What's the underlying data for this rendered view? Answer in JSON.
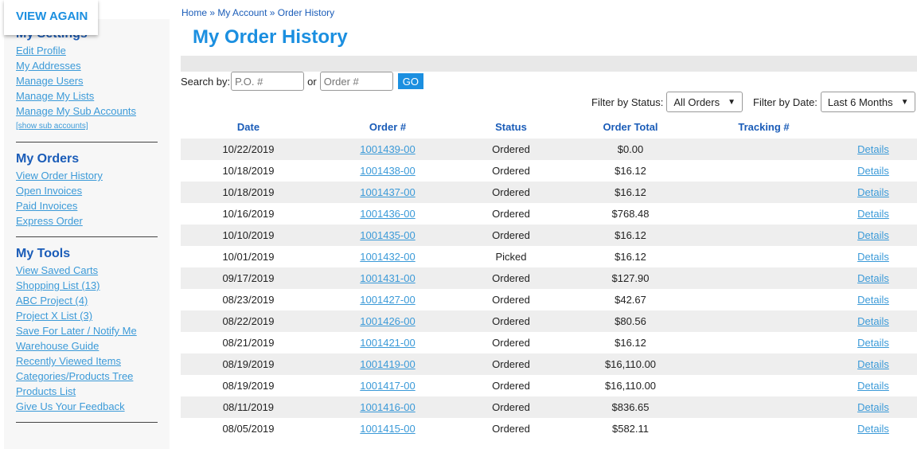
{
  "popup": {
    "label": "VIEW AGAIN"
  },
  "sidebar": {
    "settings": {
      "title": "My Settings",
      "items": [
        "Edit Profile",
        "My Addresses",
        "Manage Users",
        "Manage My Lists",
        "Manage My Sub Accounts"
      ],
      "small": "[show sub accounts]"
    },
    "orders": {
      "title": "My Orders",
      "items": [
        "View Order History",
        "Open Invoices",
        "Paid Invoices",
        "Express Order"
      ]
    },
    "tools": {
      "title": "My Tools",
      "items": [
        "View Saved Carts",
        "Shopping List (13)",
        "ABC Project (4)",
        "Project X List (3)",
        "Save For Later / Notify Me",
        "Warehouse Guide",
        "Recently Viewed Items",
        "Categories/Products Tree",
        "Products List",
        "Give Us Your Feedback"
      ]
    }
  },
  "breadcrumb": {
    "home": "Home",
    "sep": "»",
    "account": "My Account",
    "current": "Order History"
  },
  "page_title": "My Order History",
  "search": {
    "label": "Search by:",
    "po_placeholder": "P.O. #",
    "or": "or",
    "order_placeholder": "Order #",
    "go": "GO"
  },
  "filters": {
    "status_label": "Filter by Status:",
    "status_value": "All Orders",
    "date_label": "Filter by Date:",
    "date_value": "Last 6 Months"
  },
  "table": {
    "headers": [
      "Date",
      "Order #",
      "Status",
      "Order Total",
      "Tracking #",
      ""
    ],
    "details_label": "Details",
    "rows": [
      [
        "10/22/2019",
        "1001439-00",
        "Ordered",
        "$0.00"
      ],
      [
        "10/18/2019",
        "1001438-00",
        "Ordered",
        "$16.12"
      ],
      [
        "10/18/2019",
        "1001437-00",
        "Ordered",
        "$16.12"
      ],
      [
        "10/16/2019",
        "1001436-00",
        "Ordered",
        "$768.48"
      ],
      [
        "10/10/2019",
        "1001435-00",
        "Ordered",
        "$16.12"
      ],
      [
        "10/01/2019",
        "1001432-00",
        "Picked",
        "$16.12"
      ],
      [
        "09/17/2019",
        "1001431-00",
        "Ordered",
        "$127.90"
      ],
      [
        "08/23/2019",
        "1001427-00",
        "Ordered",
        "$42.67"
      ],
      [
        "08/22/2019",
        "1001426-00",
        "Ordered",
        "$80.56"
      ],
      [
        "08/21/2019",
        "1001421-00",
        "Ordered",
        "$16.12"
      ],
      [
        "08/19/2019",
        "1001419-00",
        "Ordered",
        "$16,110.00"
      ],
      [
        "08/19/2019",
        "1001417-00",
        "Ordered",
        "$16,110.00"
      ],
      [
        "08/11/2019",
        "1001416-00",
        "Ordered",
        "$836.65"
      ],
      [
        "08/05/2019",
        "1001415-00",
        "Ordered",
        "$582.11"
      ]
    ]
  }
}
